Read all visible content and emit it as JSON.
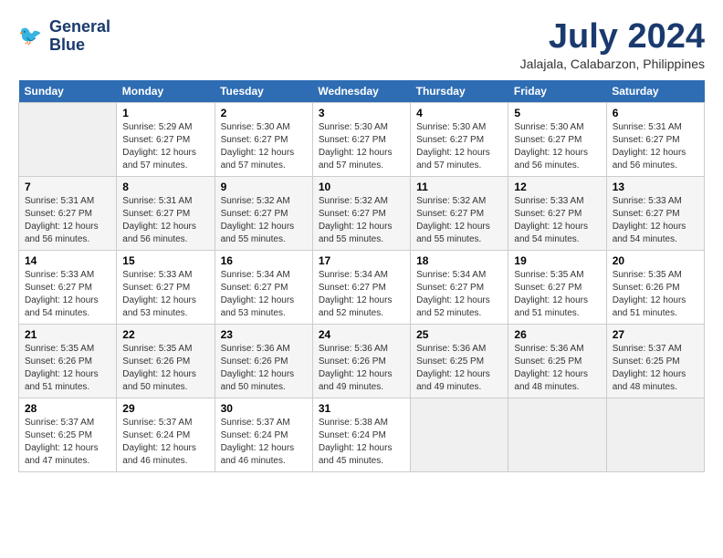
{
  "logo": {
    "line1": "General",
    "line2": "Blue"
  },
  "title": "July 2024",
  "location": "Jalajala, Calabarzon, Philippines",
  "weekdays": [
    "Sunday",
    "Monday",
    "Tuesday",
    "Wednesday",
    "Thursday",
    "Friday",
    "Saturday"
  ],
  "weeks": [
    [
      {
        "day": "",
        "info": ""
      },
      {
        "day": "1",
        "info": "Sunrise: 5:29 AM\nSunset: 6:27 PM\nDaylight: 12 hours\nand 57 minutes."
      },
      {
        "day": "2",
        "info": "Sunrise: 5:30 AM\nSunset: 6:27 PM\nDaylight: 12 hours\nand 57 minutes."
      },
      {
        "day": "3",
        "info": "Sunrise: 5:30 AM\nSunset: 6:27 PM\nDaylight: 12 hours\nand 57 minutes."
      },
      {
        "day": "4",
        "info": "Sunrise: 5:30 AM\nSunset: 6:27 PM\nDaylight: 12 hours\nand 57 minutes."
      },
      {
        "day": "5",
        "info": "Sunrise: 5:30 AM\nSunset: 6:27 PM\nDaylight: 12 hours\nand 56 minutes."
      },
      {
        "day": "6",
        "info": "Sunrise: 5:31 AM\nSunset: 6:27 PM\nDaylight: 12 hours\nand 56 minutes."
      }
    ],
    [
      {
        "day": "7",
        "info": "Sunrise: 5:31 AM\nSunset: 6:27 PM\nDaylight: 12 hours\nand 56 minutes."
      },
      {
        "day": "8",
        "info": "Sunrise: 5:31 AM\nSunset: 6:27 PM\nDaylight: 12 hours\nand 56 minutes."
      },
      {
        "day": "9",
        "info": "Sunrise: 5:32 AM\nSunset: 6:27 PM\nDaylight: 12 hours\nand 55 minutes."
      },
      {
        "day": "10",
        "info": "Sunrise: 5:32 AM\nSunset: 6:27 PM\nDaylight: 12 hours\nand 55 minutes."
      },
      {
        "day": "11",
        "info": "Sunrise: 5:32 AM\nSunset: 6:27 PM\nDaylight: 12 hours\nand 55 minutes."
      },
      {
        "day": "12",
        "info": "Sunrise: 5:33 AM\nSunset: 6:27 PM\nDaylight: 12 hours\nand 54 minutes."
      },
      {
        "day": "13",
        "info": "Sunrise: 5:33 AM\nSunset: 6:27 PM\nDaylight: 12 hours\nand 54 minutes."
      }
    ],
    [
      {
        "day": "14",
        "info": "Sunrise: 5:33 AM\nSunset: 6:27 PM\nDaylight: 12 hours\nand 54 minutes."
      },
      {
        "day": "15",
        "info": "Sunrise: 5:33 AM\nSunset: 6:27 PM\nDaylight: 12 hours\nand 53 minutes."
      },
      {
        "day": "16",
        "info": "Sunrise: 5:34 AM\nSunset: 6:27 PM\nDaylight: 12 hours\nand 53 minutes."
      },
      {
        "day": "17",
        "info": "Sunrise: 5:34 AM\nSunset: 6:27 PM\nDaylight: 12 hours\nand 52 minutes."
      },
      {
        "day": "18",
        "info": "Sunrise: 5:34 AM\nSunset: 6:27 PM\nDaylight: 12 hours\nand 52 minutes."
      },
      {
        "day": "19",
        "info": "Sunrise: 5:35 AM\nSunset: 6:27 PM\nDaylight: 12 hours\nand 51 minutes."
      },
      {
        "day": "20",
        "info": "Sunrise: 5:35 AM\nSunset: 6:26 PM\nDaylight: 12 hours\nand 51 minutes."
      }
    ],
    [
      {
        "day": "21",
        "info": "Sunrise: 5:35 AM\nSunset: 6:26 PM\nDaylight: 12 hours\nand 51 minutes."
      },
      {
        "day": "22",
        "info": "Sunrise: 5:35 AM\nSunset: 6:26 PM\nDaylight: 12 hours\nand 50 minutes."
      },
      {
        "day": "23",
        "info": "Sunrise: 5:36 AM\nSunset: 6:26 PM\nDaylight: 12 hours\nand 50 minutes."
      },
      {
        "day": "24",
        "info": "Sunrise: 5:36 AM\nSunset: 6:26 PM\nDaylight: 12 hours\nand 49 minutes."
      },
      {
        "day": "25",
        "info": "Sunrise: 5:36 AM\nSunset: 6:25 PM\nDaylight: 12 hours\nand 49 minutes."
      },
      {
        "day": "26",
        "info": "Sunrise: 5:36 AM\nSunset: 6:25 PM\nDaylight: 12 hours\nand 48 minutes."
      },
      {
        "day": "27",
        "info": "Sunrise: 5:37 AM\nSunset: 6:25 PM\nDaylight: 12 hours\nand 48 minutes."
      }
    ],
    [
      {
        "day": "28",
        "info": "Sunrise: 5:37 AM\nSunset: 6:25 PM\nDaylight: 12 hours\nand 47 minutes."
      },
      {
        "day": "29",
        "info": "Sunrise: 5:37 AM\nSunset: 6:24 PM\nDaylight: 12 hours\nand 46 minutes."
      },
      {
        "day": "30",
        "info": "Sunrise: 5:37 AM\nSunset: 6:24 PM\nDaylight: 12 hours\nand 46 minutes."
      },
      {
        "day": "31",
        "info": "Sunrise: 5:38 AM\nSunset: 6:24 PM\nDaylight: 12 hours\nand 45 minutes."
      },
      {
        "day": "",
        "info": ""
      },
      {
        "day": "",
        "info": ""
      },
      {
        "day": "",
        "info": ""
      }
    ]
  ]
}
